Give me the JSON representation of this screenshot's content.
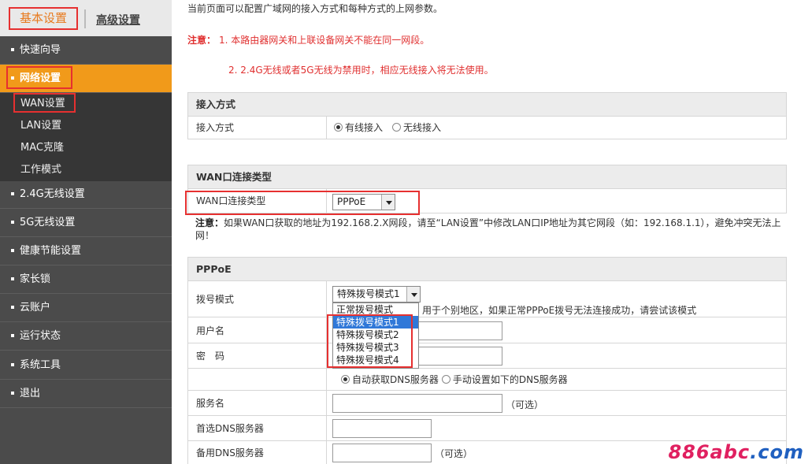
{
  "tabs": {
    "basic": "基本设置",
    "advanced": "高级设置"
  },
  "sidebar": {
    "items": [
      {
        "label": "快速向导"
      },
      {
        "label": "网络设置"
      },
      {
        "label": "2.4G无线设置"
      },
      {
        "label": "5G无线设置"
      },
      {
        "label": "健康节能设置"
      },
      {
        "label": "家长锁"
      },
      {
        "label": "云账户"
      },
      {
        "label": "运行状态"
      },
      {
        "label": "系统工具"
      },
      {
        "label": "退出"
      }
    ],
    "subitems": [
      {
        "label": "WAN设置"
      },
      {
        "label": "LAN设置"
      },
      {
        "label": "MAC克隆"
      },
      {
        "label": "工作模式"
      }
    ]
  },
  "main": {
    "intro": "当前页面可以配置广域网的接入方式和每种方式的上网参数。",
    "note_label": "注意：",
    "note1": "1.  本路由器网关和上联设备网关不能在同一网段。",
    "note2": "2.  2.4G无线或者5G无线为禁用时，相应无线接入将无法使用。",
    "access": {
      "section_title": "接入方式",
      "label": "接入方式",
      "options": [
        "有线接入",
        "无线接入"
      ],
      "selected": "有线接入"
    },
    "wan_type": {
      "section_title": "WAN口连接类型",
      "label": "WAN口连接类型",
      "value": "PPPoE",
      "warn_label": "注意：",
      "warn_text": "如果WAN口获取的地址为192.168.2.X网段，请至“LAN设置”中修改LAN口IP地址为其它网段（如：192.168.1.1），避免冲突无法上网！"
    },
    "pppoe": {
      "section_title": "PPPoE",
      "dial_label": "拨号模式",
      "dial_value": "特殊拨号模式1",
      "dial_hint": "用于个别地区，如果正常PPPoE拨号无法连接成功，请尝试该模式",
      "dial_options": [
        "正常拨号模式",
        "特殊拨号模式1",
        "特殊拨号模式2",
        "特殊拨号模式3",
        "特殊拨号模式4"
      ],
      "username_label": "用户名",
      "password_label": "密　码",
      "dns_auto": "自动获取DNS服务器",
      "dns_manual": "手动设置如下的DNS服务器",
      "service_label": "服务名",
      "optional": "（可选）",
      "dns1_label": "首选DNS服务器",
      "dns2_label": "备用DNS服务器"
    }
  },
  "watermark": {
    "part1": "886abc",
    "part2": ".com"
  }
}
